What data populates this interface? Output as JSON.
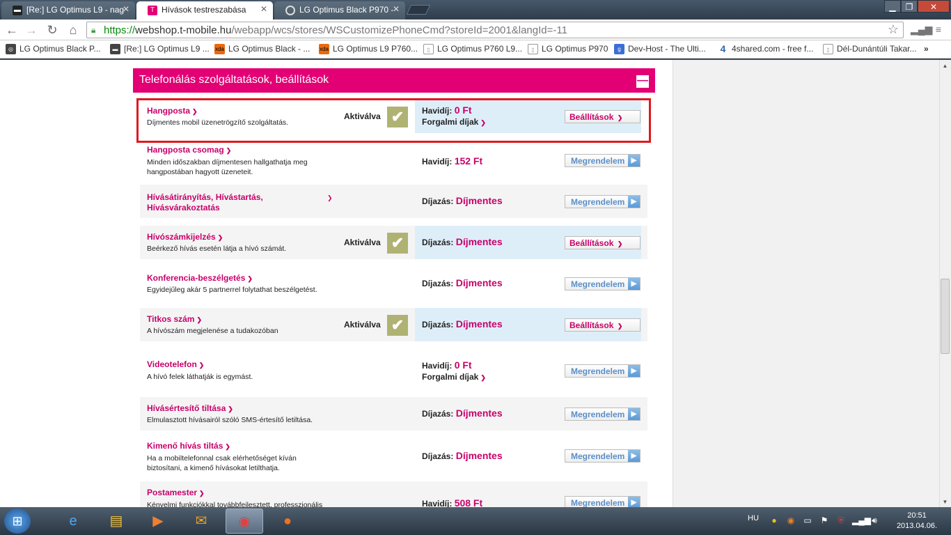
{
  "browser": {
    "tabs": [
      {
        "label": "[Re:] LG Optimus L9 - nag",
        "icon": "forum-icon",
        "active": false
      },
      {
        "label": "Hívások testreszabása",
        "icon": "telekom-icon",
        "active": true
      },
      {
        "label": "LG Optimus Black P970 - ",
        "icon": "loading-icon",
        "active": false
      }
    ],
    "close_glyph": "✕",
    "window_controls": {
      "minimize": "▁",
      "maximize": "❐",
      "close": "✕"
    },
    "url": {
      "scheme": "https://",
      "host": "webshop.t-mobile.hu",
      "path": "/webapp/wcs/stores/WSCustomizePhoneCmd?storeId=2001&langId=-11"
    },
    "bookmarks": [
      {
        "label": "LG Optimus Black P...",
        "icon": "globe-icon"
      },
      {
        "label": "[Re:] LG Optimus L9 ...",
        "icon": "forum-icon"
      },
      {
        "label": "LG Optimus Black - ...",
        "icon": "xda-icon"
      },
      {
        "label": "LG Optimus L9 P760...",
        "icon": "xda-icon"
      },
      {
        "label": "LG Optimus P760 L9...",
        "icon": "document-icon"
      },
      {
        "label": "LG Optimus P970",
        "icon": "document-icon"
      },
      {
        "label": "Dev-Host - The Ulti...",
        "icon": "google-icon"
      },
      {
        "label": "4shared.com - free f...",
        "icon": "4shared-icon"
      },
      {
        "label": "Dél-Dunántúli Takar...",
        "icon": "document-icon"
      }
    ],
    "bookmarks_overflow": "»"
  },
  "page": {
    "section_title": "Telefonálás szolgáltatások, beállítások",
    "collapse_glyph": "—",
    "activated_label": "Aktiválva",
    "services": [
      {
        "name": "Hangposta",
        "desc": "Díjmentes mobil üzenetrögzítő szolgáltatás.",
        "activated": true,
        "price_label": "Havidíj:",
        "price_value": "0 Ft",
        "extra_link": "Forgalmi díjak",
        "button": "Beállítások",
        "blue": true
      },
      {
        "name": "Hangposta csomag",
        "desc": "Minden időszakban díjmentesen hallgathatja meg hangpostában hagyott üzeneteit.",
        "activated": false,
        "price_label": "Havidíj:",
        "price_value": "152 Ft",
        "button": "Megrendelem"
      },
      {
        "name": "Hívásátirányítás, Hívástartás, Hívásvárakoztatás",
        "desc": "",
        "activated": false,
        "price_label": "Díjazás:",
        "price_value": "Díjmentes",
        "button": "Megrendelem"
      },
      {
        "name": "Hívószámkijelzés",
        "desc": "Beérkező hívás esetén látja a hívó számát.",
        "activated": true,
        "price_label": "Díjazás:",
        "price_value": "Díjmentes",
        "button": "Beállítások",
        "blue": true
      },
      {
        "name": "Konferencia-beszélgetés",
        "desc": "Egyidejűleg akár 5 partnerrel folytathat beszélgetést.",
        "activated": false,
        "price_label": "Díjazás:",
        "price_value": "Díjmentes",
        "button": "Megrendelem"
      },
      {
        "name": "Titkos szám",
        "desc": "A hívószám megjelenése a tudakozóban",
        "activated": true,
        "price_label": "Díjazás:",
        "price_value": "Díjmentes",
        "button": "Beállítások",
        "blue": true
      },
      {
        "name": "Videotelefon",
        "desc": "A hívó felek láthatják is egymást.",
        "activated": false,
        "price_label": "Havidíj:",
        "price_value": "0 Ft",
        "extra_link": "Forgalmi díjak",
        "button": "Megrendelem"
      },
      {
        "name": "Hívásértesítő tiltása",
        "desc": "Elmulasztott hívásairól szóló SMS-értesítő letiltása.",
        "activated": false,
        "price_label": "Díjazás:",
        "price_value": "Díjmentes",
        "button": "Megrendelem"
      },
      {
        "name": "Kimenő hívás tiltás",
        "desc": "Ha a mobiltelefonnal csak elérhetőséget kíván biztosítani, a kimenő hívásokat letilthatja.",
        "activated": false,
        "price_label": "Díjazás:",
        "price_value": "Díjmentes",
        "button": "Megrendelem"
      },
      {
        "name": "Postamester",
        "desc": "Kényelmi funkciókkal továbbfejlesztett, professzionális",
        "activated": false,
        "price_label": "Havidíj:",
        "price_value": "508 Ft",
        "button": "Megrendelem"
      }
    ]
  },
  "taskbar": {
    "apps": [
      "ie-icon",
      "explorer-icon",
      "media-player-icon",
      "outlook-icon",
      "chrome-icon",
      "firefox-icon"
    ],
    "active_app": "chrome-icon",
    "language": "HU",
    "time": "20:51",
    "date": "2013.04.06."
  },
  "colors": {
    "brand": "#e20074",
    "highlight": "#e0191f",
    "check": "#b0b273",
    "blue_bg": "#deeef9"
  }
}
